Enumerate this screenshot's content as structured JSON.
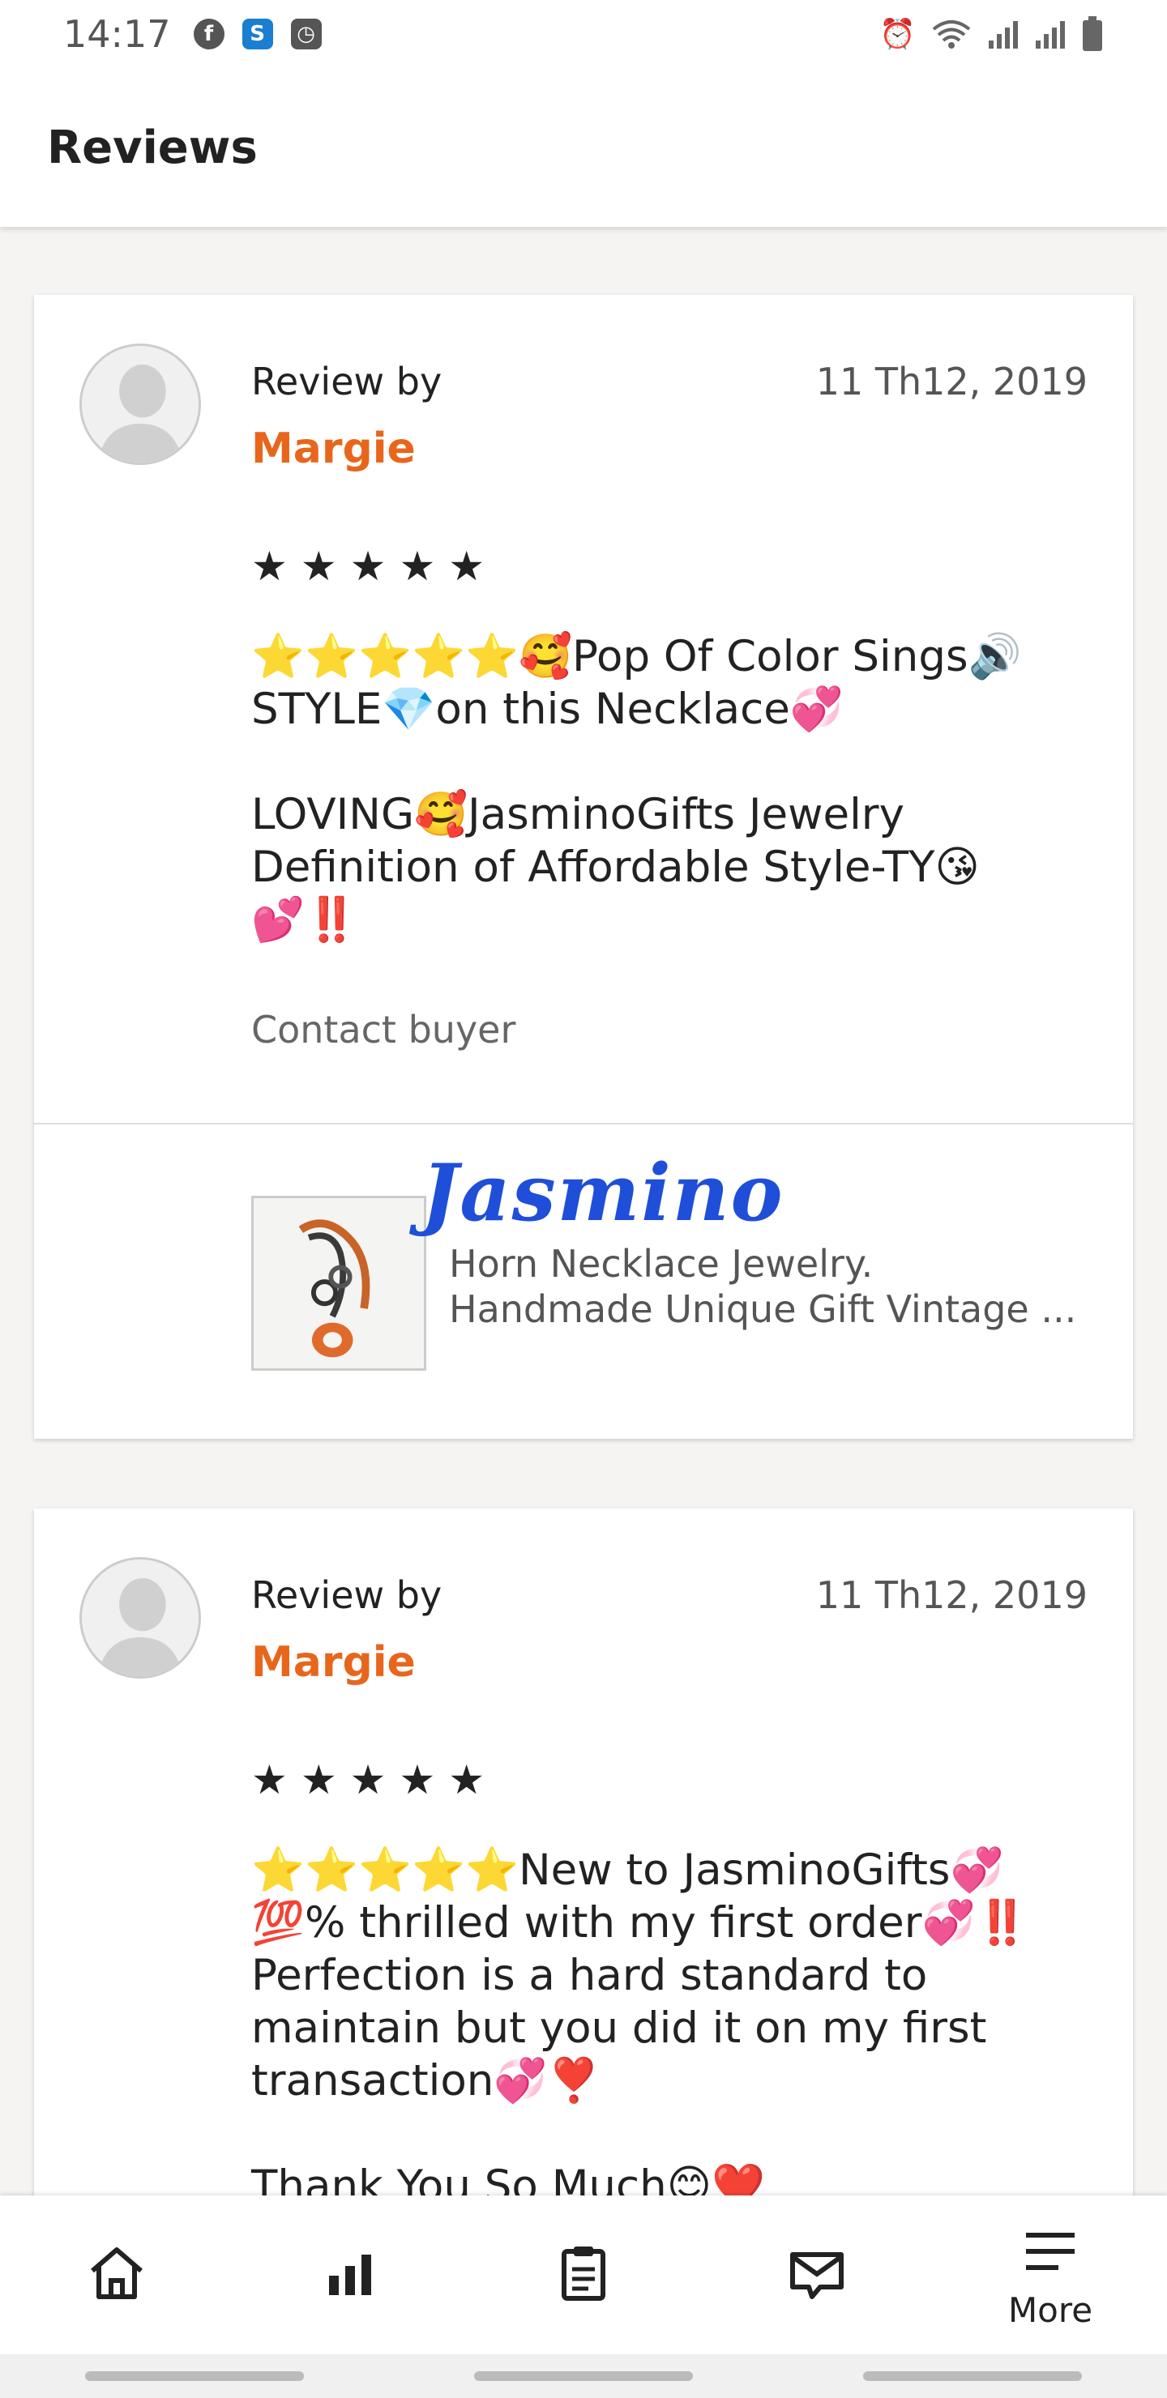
{
  "status_bar": {
    "time": "14:17",
    "left_icons": [
      "facebook-icon",
      "s-app-icon",
      "clock-app-icon"
    ],
    "right_icons": [
      "alarm-icon",
      "wifi-icon",
      "signal-icon",
      "signal-icon",
      "battery-icon"
    ]
  },
  "header": {
    "title": "Reviews"
  },
  "reviews": [
    {
      "review_by_label": "Review by",
      "reviewer": "Margie",
      "date": "11 Th12, 2019",
      "stars": "★★★★★",
      "text": "⭐⭐⭐⭐⭐🥰Pop Of Color Sings🔊\nSTYLE💎on this Necklace💞\n\nLOVING🥰JasminoGifts Jewelry\nDefinition of Affordable Style-TY😘\n💕‼️",
      "contact_label": "Contact buyer",
      "product": {
        "brand": "Jasmino",
        "title_line1": "Horn Necklace Jewelry.",
        "title_line2": "Handmade Unique Gift Vintage ..."
      }
    },
    {
      "review_by_label": "Review by",
      "reviewer": "Margie",
      "date": "11 Th12, 2019",
      "stars": "★★★★★",
      "text": "⭐⭐⭐⭐⭐New to JasminoGifts💞\n💯% thrilled with my first order💞‼️\nPerfection is a hard standard to\nmaintain but you did it on my first\ntransaction💞❣️\n\nThank You So Much😊❤️"
    }
  ],
  "bottom_nav": {
    "items": [
      {
        "icon": "home-icon",
        "label": ""
      },
      {
        "icon": "stats-icon",
        "label": ""
      },
      {
        "icon": "orders-icon",
        "label": ""
      },
      {
        "icon": "messages-icon",
        "label": ""
      },
      {
        "icon": "menu-icon",
        "label": "More"
      }
    ]
  }
}
